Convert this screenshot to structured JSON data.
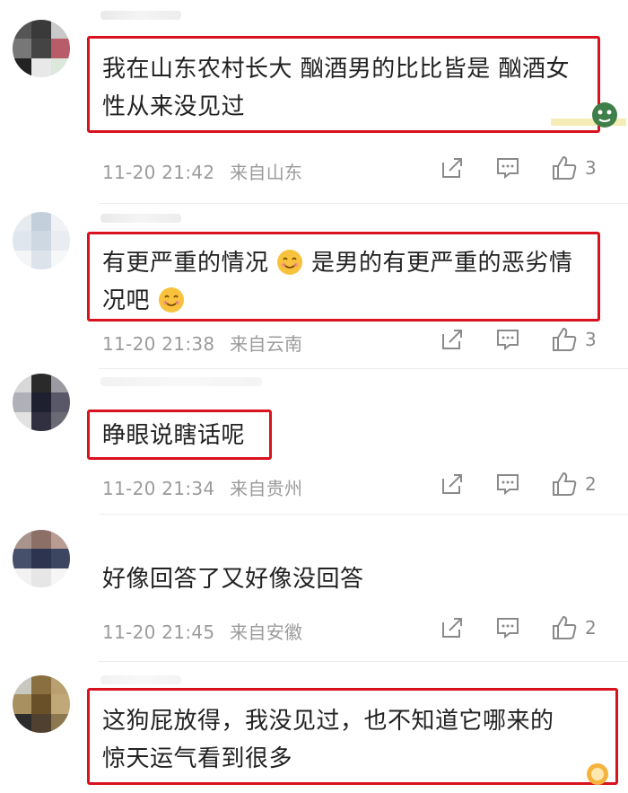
{
  "comments": [
    {
      "content_lines": [
        "我在山东农村长大 酗酒男的比比皆是 酗酒女",
        "性从来没见过"
      ],
      "time": "11-20 21:42",
      "location": "来自山东",
      "likes": "3",
      "highlighted": true
    },
    {
      "content_parts": [
        "有更严重的情况",
        "是男的有更严重的恶劣情",
        "况吧"
      ],
      "emoji": "smile-emoji",
      "time": "11-20 21:38",
      "location": "来自云南",
      "likes": "3",
      "highlighted": true
    },
    {
      "content_lines": [
        "睁眼说瞎话呢"
      ],
      "time": "11-20 21:34",
      "location": "来自贵州",
      "likes": "2",
      "highlighted": true
    },
    {
      "content_lines": [
        "好像回答了又好像没回答"
      ],
      "time": "11-20 21:45",
      "location": "来自安徽",
      "likes": "2",
      "highlighted": false
    },
    {
      "content_lines": [
        "这狗屁放得，我没见过，也不知道它哪来的",
        "惊天运气看到很多"
      ],
      "highlighted": true
    }
  ],
  "icons": {
    "share": "share-icon",
    "comment": "comment-icon",
    "like": "thumbs-up-icon"
  },
  "colors": {
    "highlight_box": "#d8121f",
    "meta_text": "#9b9b9b",
    "content_text": "#222222"
  }
}
